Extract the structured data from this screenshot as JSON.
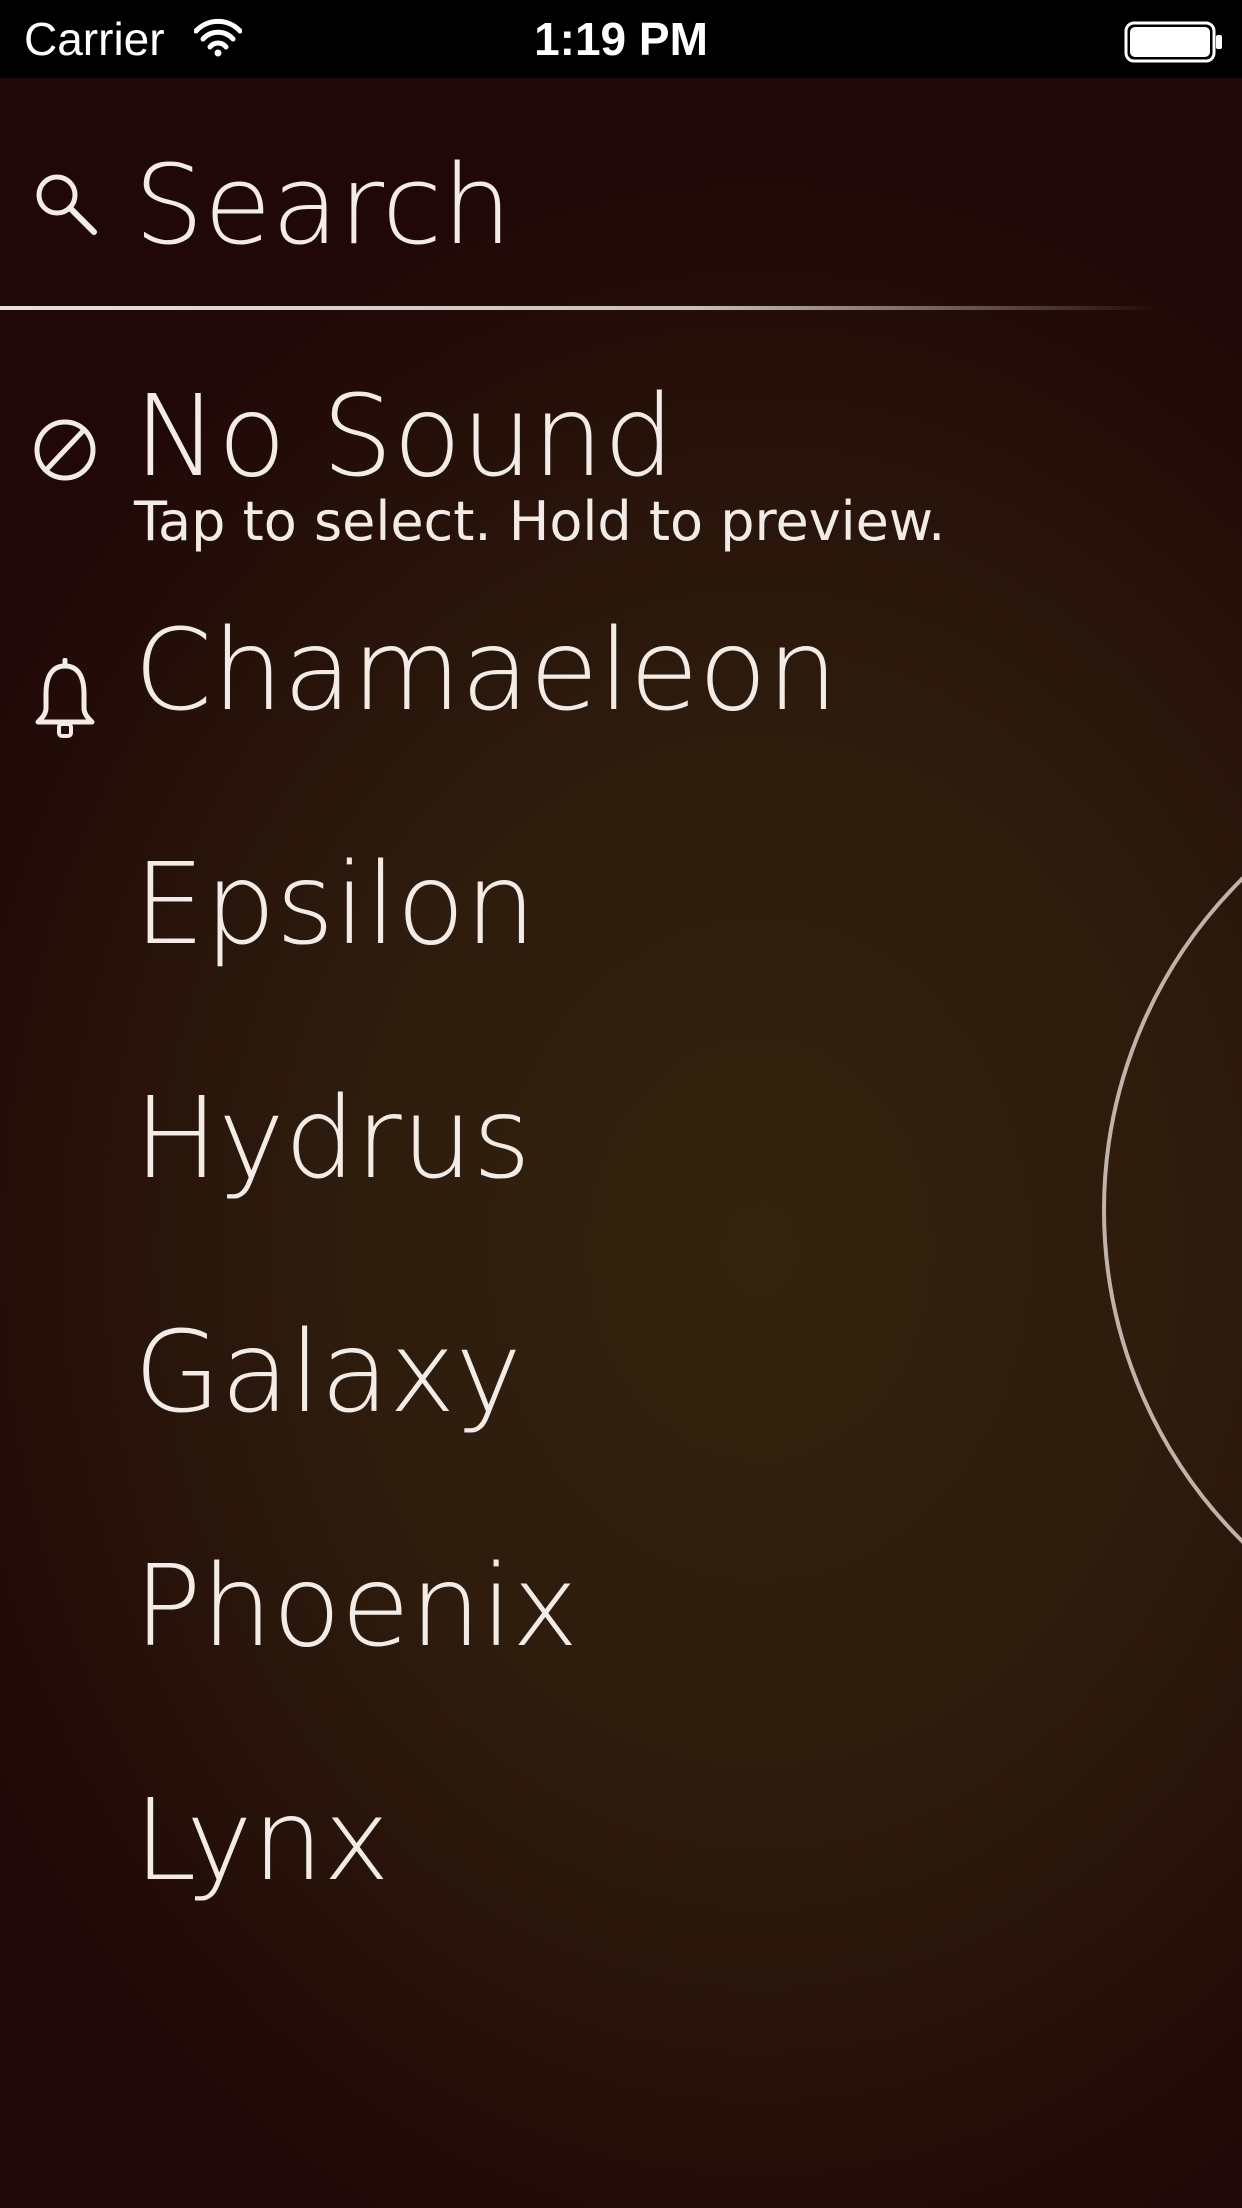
{
  "status_bar": {
    "carrier": "Carrier",
    "time": "1:19 PM",
    "icons": [
      "wifi-icon",
      "battery-icon"
    ]
  },
  "search": {
    "placeholder": "Search",
    "value": "",
    "icon": "search-icon"
  },
  "sounds": {
    "no_sound": {
      "label": "No Sound",
      "hint": "Tap to select. Hold to preview.",
      "icon": "no-sound-icon"
    },
    "items": [
      {
        "label": "Chamaeleon",
        "icon": "bell-icon",
        "selected": true
      },
      {
        "label": "Epsilon"
      },
      {
        "label": "Hydrus"
      },
      {
        "label": "Galaxy"
      },
      {
        "label": "Phoenix"
      },
      {
        "label": "Lynx"
      }
    ]
  },
  "colors": {
    "background_top": "#260c08",
    "background_center": "#33240d",
    "text": "#f2ece6",
    "status_bar": "#000000"
  }
}
